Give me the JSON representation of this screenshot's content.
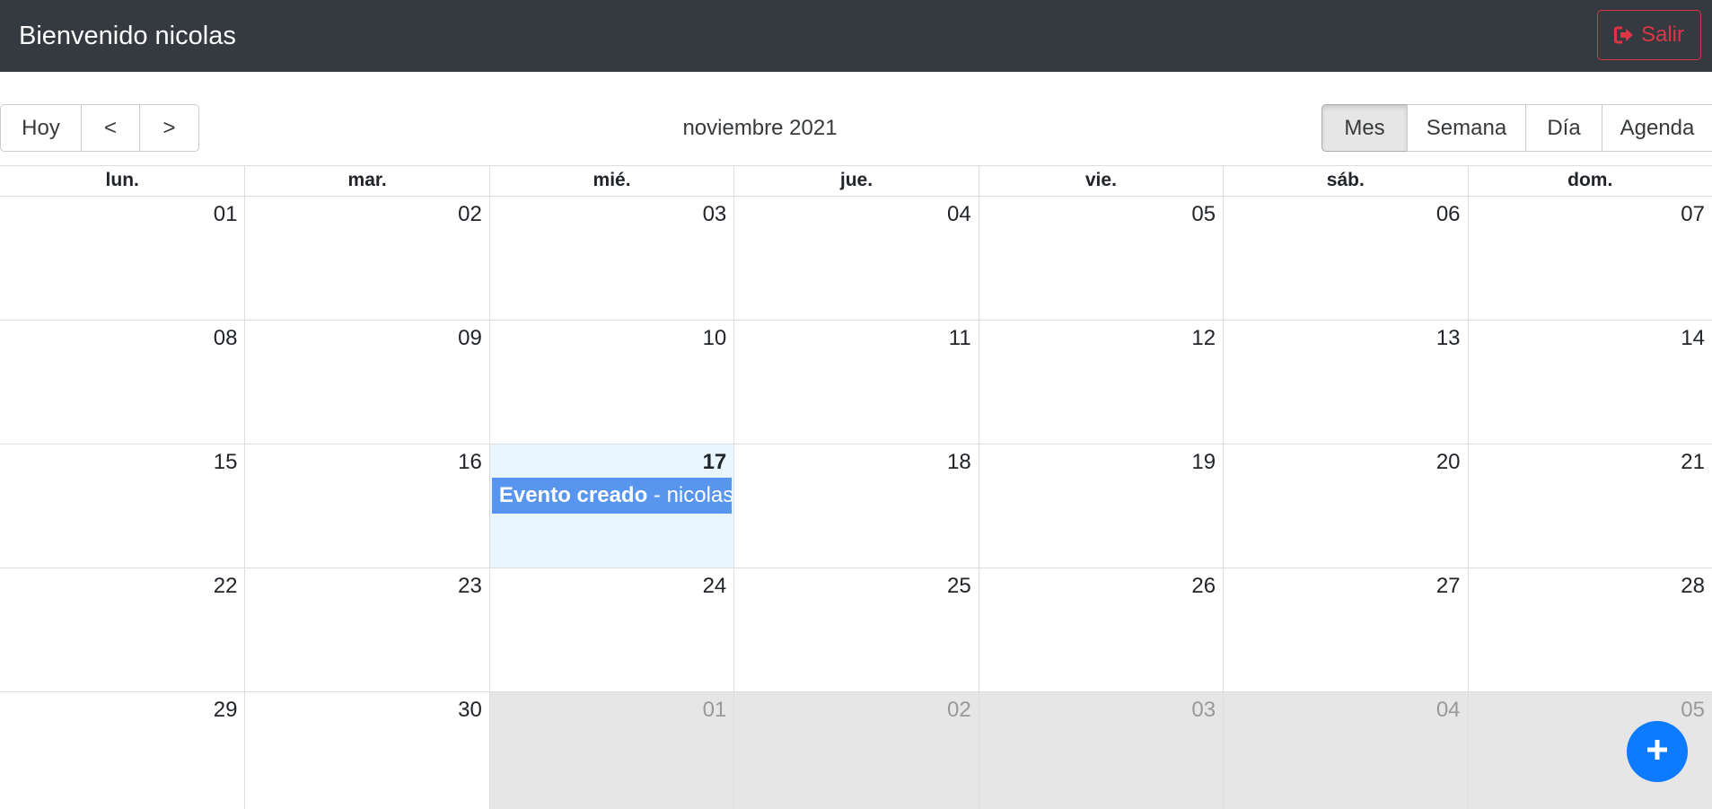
{
  "header": {
    "welcome": "Bienvenido nicolas",
    "logout_label": "Salir",
    "logout_color": "#dc3545",
    "background": "#343a40"
  },
  "toolbar": {
    "today_label": "Hoy",
    "prev_label": "<",
    "next_label": ">",
    "month_label": "noviembre 2021",
    "views": [
      "Mes",
      "Semana",
      "Día",
      "Agenda"
    ],
    "active_view": "Mes"
  },
  "calendar": {
    "weekdays": [
      "lun.",
      "mar.",
      "mié.",
      "jue.",
      "vie.",
      "sáb.",
      "dom."
    ],
    "weeks": [
      [
        {
          "d": "01"
        },
        {
          "d": "02"
        },
        {
          "d": "03"
        },
        {
          "d": "04"
        },
        {
          "d": "05"
        },
        {
          "d": "06"
        },
        {
          "d": "07"
        }
      ],
      [
        {
          "d": "08"
        },
        {
          "d": "09"
        },
        {
          "d": "10"
        },
        {
          "d": "11"
        },
        {
          "d": "12"
        },
        {
          "d": "13"
        },
        {
          "d": "14"
        }
      ],
      [
        {
          "d": "15"
        },
        {
          "d": "16"
        },
        {
          "d": "17",
          "today": true
        },
        {
          "d": "18"
        },
        {
          "d": "19"
        },
        {
          "d": "20"
        },
        {
          "d": "21"
        }
      ],
      [
        {
          "d": "22"
        },
        {
          "d": "23"
        },
        {
          "d": "24"
        },
        {
          "d": "25"
        },
        {
          "d": "26"
        },
        {
          "d": "27"
        },
        {
          "d": "28"
        }
      ],
      [
        {
          "d": "29"
        },
        {
          "d": "30"
        },
        {
          "d": "01",
          "off": true
        },
        {
          "d": "02",
          "off": true
        },
        {
          "d": "03",
          "off": true
        },
        {
          "d": "04",
          "off": true
        },
        {
          "d": "05",
          "off": true
        }
      ]
    ],
    "event": {
      "title": "Evento creado",
      "separator": " - ",
      "user": "nicolas",
      "color": "#5795ee"
    }
  },
  "fab": {
    "icon": "plus-icon",
    "color": "#0d7bff"
  }
}
